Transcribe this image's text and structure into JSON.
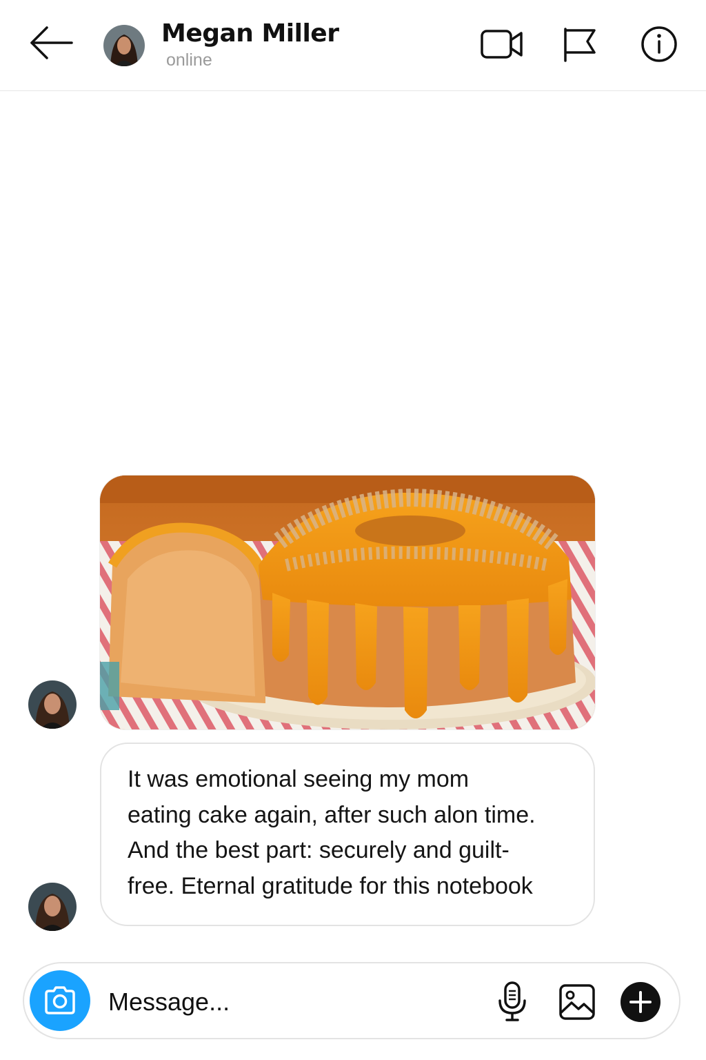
{
  "header": {
    "contact_name": "Megan Miller",
    "status": "online",
    "icons": [
      "back-arrow-icon",
      "video-call-icon",
      "flag-icon",
      "info-icon"
    ]
  },
  "conversation": {
    "messages": [
      {
        "type": "image",
        "sender": "Megan Miller",
        "image_description_icon": "bundt-cake-photo"
      },
      {
        "type": "text",
        "sender": "Megan Miller",
        "lines": [
          "It was emotional seeing my mom",
          "eating cake again, after such alon time.",
          "And the best part: securely and guilt-",
          "free. Eternal gratitude for this notebook"
        ]
      }
    ]
  },
  "composer": {
    "placeholder": "Message...",
    "icons": [
      "camera-icon",
      "microphone-icon",
      "gallery-icon",
      "plus-icon"
    ]
  },
  "colors": {
    "accent": "#1aa3ff",
    "border": "#e3e3e3",
    "status_gray": "#9a9a9a"
  }
}
